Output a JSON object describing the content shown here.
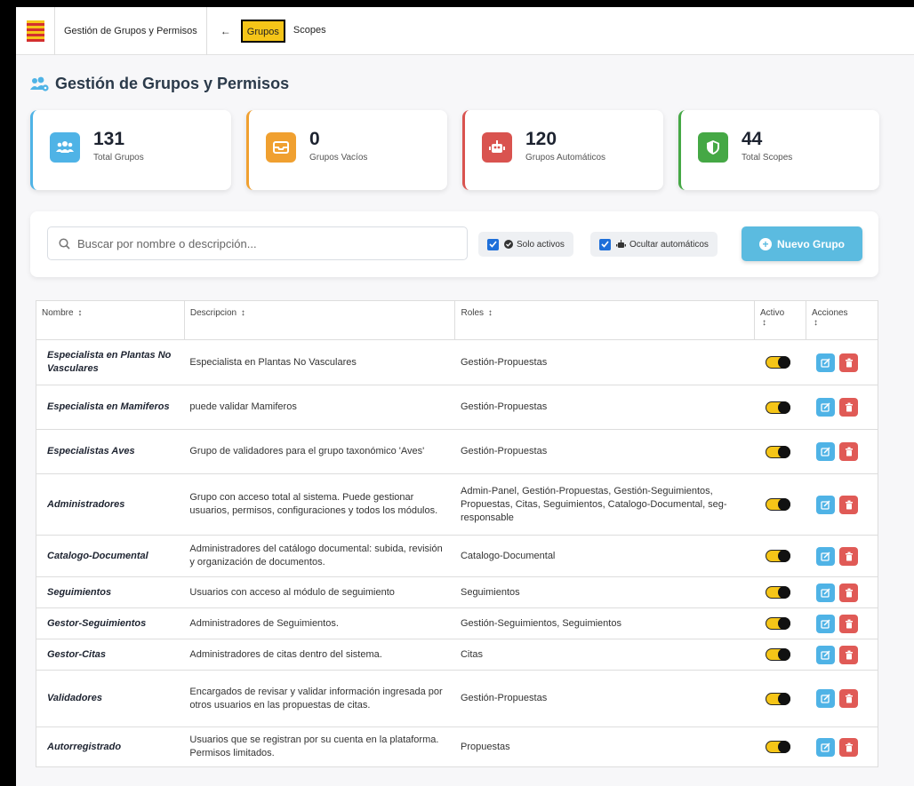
{
  "nav": {
    "title": "Gestión de Grupos y Permisos",
    "back": "←",
    "tabs": [
      {
        "label": "Grupos",
        "active": true
      },
      {
        "label": "Scopes",
        "active": false
      }
    ]
  },
  "page": {
    "title": "Gestión de Grupos y Permisos"
  },
  "stats": [
    {
      "value": "131",
      "label": "Total Grupos",
      "color": "#4fb3e6",
      "icon": "users-icon"
    },
    {
      "value": "0",
      "label": "Grupos Vacíos",
      "color": "#f0a030",
      "icon": "inbox-icon"
    },
    {
      "value": "120",
      "label": "Grupos Automáticos",
      "color": "#d9534f",
      "icon": "robot-icon"
    },
    {
      "value": "44",
      "label": "Total Scopes",
      "color": "#45a845",
      "icon": "shield-icon"
    }
  ],
  "filters": {
    "search_placeholder": "Buscar por nombre o descripción...",
    "solo_activos": "Solo activos",
    "ocultar_automaticos": "Ocultar automáticos",
    "new_group": "Nuevo Grupo"
  },
  "table": {
    "headers": {
      "nombre": "Nombre",
      "descripcion": "Descripcion",
      "roles": "Roles",
      "activo": "Activo",
      "acciones": "Acciones",
      "sort": "↕"
    },
    "rows": [
      {
        "name": "Especialista en Plantas No Vasculares",
        "desc": "Especialista en Plantas No Vasculares",
        "roles": "Gestión-Propuestas",
        "active": true
      },
      {
        "name": "Especialista en Mamiferos",
        "desc": "puede validar Mamiferos",
        "roles": "Gestión-Propuestas",
        "active": true
      },
      {
        "name": "Especialistas Aves",
        "desc": "Grupo de validadores para el grupo taxonómico 'Aves'",
        "roles": "Gestión-Propuestas",
        "active": true
      },
      {
        "name": "Administradores",
        "desc": "Grupo con acceso total al sistema. Puede gestionar usuarios, permisos, configuraciones y todos los módulos.",
        "roles": "Admin-Panel, Gestión-Propuestas, Gestión-Seguimientos, Propuestas, Citas, Seguimientos, Catalogo-Documental, seg-responsable",
        "active": true
      },
      {
        "name": "Catalogo-Documental",
        "desc": "Administradores del catálogo documental: subida, revisión y organización de documentos.",
        "roles": "Catalogo-Documental",
        "active": true
      },
      {
        "name": "Seguimientos",
        "desc": "Usuarios con acceso al módulo de seguimiento",
        "roles": "Seguimientos",
        "active": true
      },
      {
        "name": "Gestor-Seguimientos",
        "desc": "Administradores de Seguimientos.",
        "roles": "Gestión-Seguimientos, Seguimientos",
        "active": true
      },
      {
        "name": "Gestor-Citas",
        "desc": "Administradores de citas dentro del sistema.",
        "roles": "Citas",
        "active": true
      },
      {
        "name": "Validadores",
        "desc": "Encargados de revisar y validar información ingresada por otros usuarios en las propuestas de citas.",
        "roles": "Gestión-Propuestas",
        "active": true
      },
      {
        "name": "Autorregistrado",
        "desc": "Usuarios que se registran por su cuenta en la plataforma. Permisos limitados.",
        "roles": "Propuestas",
        "active": true
      }
    ]
  }
}
